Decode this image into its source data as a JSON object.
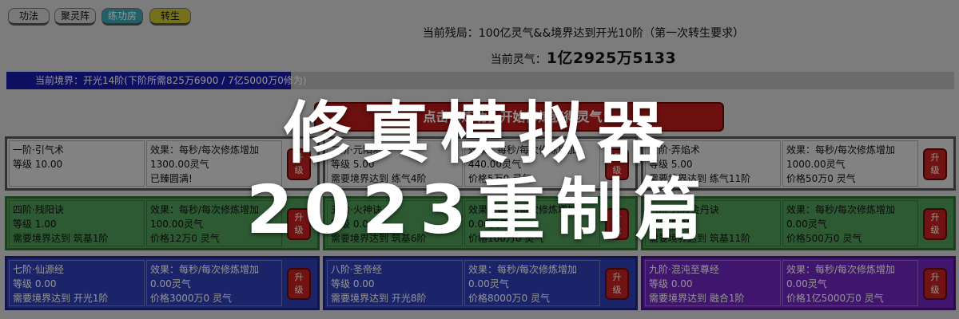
{
  "tabs": [
    {
      "label": "功法"
    },
    {
      "label": "聚灵阵"
    },
    {
      "label": "练功房"
    },
    {
      "label": "转生"
    }
  ],
  "status": {
    "goal": "当前残局：100亿灵气&&境界达到开光10阶（第一次转生要求）",
    "qi_label": "当前灵气：",
    "qi_value": "1亿2925万5133",
    "realm": "当前境界：开光14阶(下阶所需825万6900 / 7亿5000万0修为)",
    "realm_progress_percent": 30
  },
  "cultivate_button": "点击修炼功，开始修炼获得灵气！",
  "skills": [
    {
      "name": "一阶·引气术",
      "level": "等级 10.00",
      "req": "",
      "effect": "效果：每秒/每次修炼增加",
      "effect_value": "1300.00灵气",
      "price": "已臻圆满!",
      "upgrade": "升级",
      "color": "gray"
    },
    {
      "name": "二阶·元阳术",
      "level": "等级 5.00",
      "req": "需要境界达到 练气4阶",
      "effect": "效果：每秒/每次修炼增加",
      "effect_value": "440.00灵气",
      "price": "价格5万0 灵气",
      "upgrade": "升级",
      "color": "gray"
    },
    {
      "name": "三阶·弄焰术",
      "level": "等级 5.00",
      "req": "需要境界达到 练气11阶",
      "effect": "效果：每秒/每次修炼增加",
      "effect_value": "1000.00灵气",
      "price": "价格50万0 灵气",
      "upgrade": "升级",
      "color": "gray"
    },
    {
      "name": "四阶·残阳诀",
      "level": "等级 1.00",
      "req": "需要境界达到 筑基1阶",
      "effect": "效果：每秒/每次修炼增加",
      "effect_value": "100.00灵气",
      "price": "价格12万0 灵气",
      "upgrade": "升级",
      "color": "green"
    },
    {
      "name": "五阶·火神诀",
      "level": "等级 0.00",
      "req": "需要境界达到 筑基6阶",
      "effect": "效果：每秒/每次修炼增加",
      "effect_value": "0.00灵气",
      "price": "价格100万0 灵气",
      "upgrade": "升级",
      "color": "green"
    },
    {
      "name": "六阶·九转金丹诀",
      "level": "等级 0.00",
      "req": "需要境界达到 筑基11阶",
      "effect": "效果：每秒/每次修炼增加",
      "effect_value": "0.00灵气",
      "price": "价格500万0 灵气",
      "upgrade": "升级",
      "color": "green"
    },
    {
      "name": "七阶·仙源经",
      "level": "等级 0.00",
      "req": "需要境界达到 开光1阶",
      "effect": "效果：每秒/每次修炼增加",
      "effect_value": "0.00灵气",
      "price": "价格3000万0 灵气",
      "upgrade": "升级",
      "color": "blue"
    },
    {
      "name": "八阶·圣帝经",
      "level": "等级 0.00",
      "req": "需要境界达到 开光8阶",
      "effect": "效果：每秒/每次修炼增加",
      "effect_value": "0.00灵气",
      "price": "价格8000万0 灵气",
      "upgrade": "升级",
      "color": "blue"
    },
    {
      "name": "九阶·混沌至尊经",
      "level": "等级 0.00",
      "req": "需要境界达到 融合1阶",
      "effect": "效果：每秒/每次修炼增加",
      "effect_value": "0.00灵气",
      "price": "价格1亿5000万0 灵气",
      "upgrade": "升级",
      "color": "purple"
    }
  ],
  "headline": {
    "line1": "修真模拟器",
    "line2": "2023重制篇"
  }
}
